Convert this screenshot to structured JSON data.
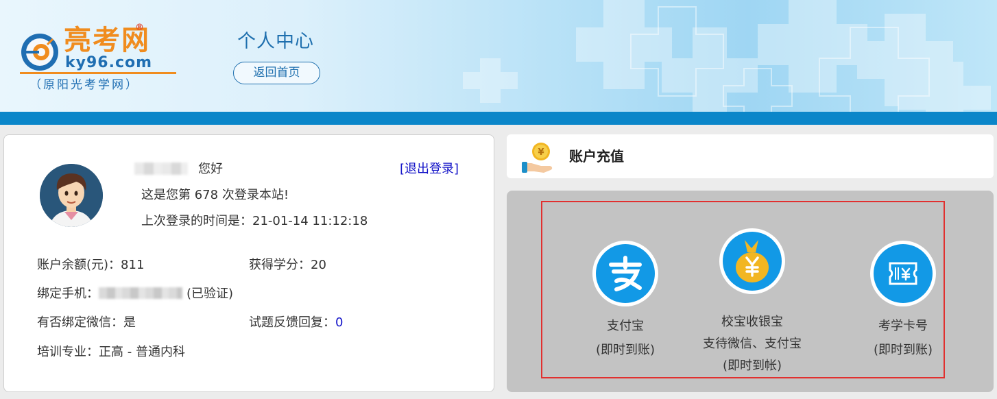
{
  "header": {
    "logo_title": "亮考网",
    "logo_reg": "®",
    "logo_url": "ky96.com",
    "logo_sub": "（原阳光考学网）",
    "page_title": "个人中心",
    "home_button": "返回首页"
  },
  "user": {
    "greeting": "您好",
    "logout": "[退出登录]",
    "login_count_prefix": "这是您第 ",
    "login_count": "678",
    "login_count_suffix": " 次登录本站!",
    "last_login_label": "上次登录的时间是：",
    "last_login_time": "21-01-14 11:12:18"
  },
  "info": {
    "balance_label": "账户余额(元)：",
    "balance_value": "811",
    "credits_label": "获得学分：",
    "credits_value": "20",
    "phone_label": "绑定手机：",
    "phone_status": "(已验证)",
    "wechat_label": "有否绑定微信：",
    "wechat_value": "是",
    "feedback_label": "试题反馈回复：",
    "feedback_value": "0",
    "major_label": "培训专业：",
    "major_value": "正高 - 普通内科"
  },
  "recharge": {
    "title": "账户充值",
    "options": [
      {
        "name": "支付宝",
        "note": "(即时到账)",
        "icon": "alipay-icon"
      },
      {
        "name": "校宝收银宝",
        "note1": "支待微信、支付宝",
        "note": "(即时到帐)",
        "icon": "money-bag-icon"
      },
      {
        "name": "考学卡号",
        "note": "(即时到账)",
        "icon": "card-ticket-icon"
      }
    ]
  },
  "colors": {
    "brand_blue": "#0b86c9",
    "brand_orange": "#f08c1e",
    "link_blue": "#1414c8",
    "highlight_red": "#e1302f",
    "payment_blue": "#1299e6"
  }
}
